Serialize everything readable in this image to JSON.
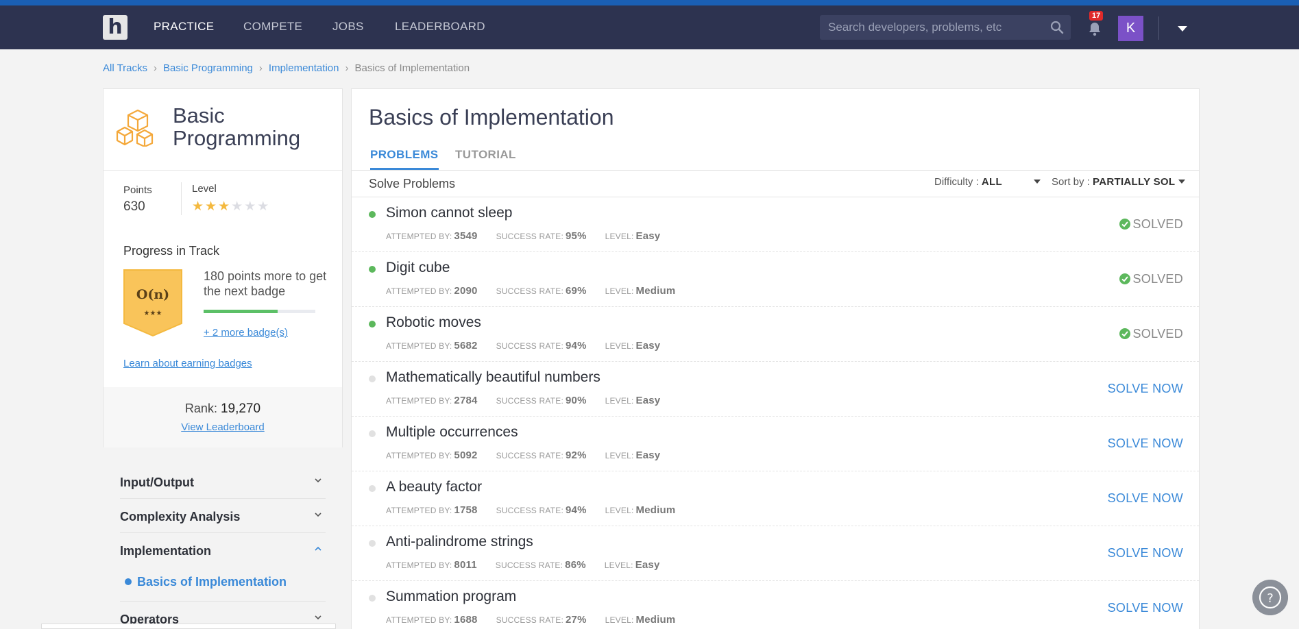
{
  "nav": {
    "logo": "h",
    "links": [
      "PRACTICE",
      "COMPETE",
      "JOBS",
      "LEADERBOARD"
    ],
    "search_placeholder": "Search developers, problems, etc",
    "notifications": "17",
    "avatar": "K"
  },
  "breadcrumb": [
    "All Tracks",
    "Basic Programming",
    "Implementation",
    "Basics of Implementation"
  ],
  "sidebar": {
    "track_title": "Basic Programming",
    "points_label": "Points",
    "points": "630",
    "level_label": "Level",
    "level_stars": 3,
    "level_max": 6,
    "progress_title": "Progress in Track",
    "badge_text": "O(n)",
    "badge_stars": "★★★",
    "progress_text": "180 points more to get the next badge",
    "progress": 0.66,
    "more_badges": "+ 2 more badge(s)",
    "learn_link": "Learn about earning badges",
    "rank_label": "Rank: ",
    "rank": "19,270",
    "view_leaderboard": "View Leaderboard",
    "topics": [
      "Input/Output",
      "Complexity Analysis",
      "Implementation",
      "Operators"
    ],
    "active_subtopic": "Basics of Implementation"
  },
  "main": {
    "title": "Basics of Implementation",
    "tabs": [
      "PROBLEMS",
      "TUTORIAL"
    ],
    "solve_label": "Solve Problems",
    "difficulty_label": "Difficulty : ",
    "difficulty_value": "ALL",
    "sort_label": "Sort by : ",
    "sort_value": "PARTIALLY SOL",
    "meta_labels": {
      "attempted": "ATTEMPTED BY:",
      "success": "SUCCESS RATE:",
      "level": "LEVEL:"
    },
    "problems": [
      {
        "name": "Simon cannot sleep",
        "attempted": "3549",
        "success": "95%",
        "level": "Easy",
        "status": "SOLVED"
      },
      {
        "name": "Digit cube",
        "attempted": "2090",
        "success": "69%",
        "level": "Medium",
        "status": "SOLVED"
      },
      {
        "name": "Robotic moves",
        "attempted": "5682",
        "success": "94%",
        "level": "Easy",
        "status": "SOLVED"
      },
      {
        "name": "Mathematically beautiful numbers",
        "attempted": "2784",
        "success": "90%",
        "level": "Easy",
        "status": "SOLVE NOW"
      },
      {
        "name": "Multiple occurrences",
        "attempted": "5092",
        "success": "92%",
        "level": "Easy",
        "status": "SOLVE NOW"
      },
      {
        "name": "A beauty factor",
        "attempted": "1758",
        "success": "94%",
        "level": "Medium",
        "status": "SOLVE NOW"
      },
      {
        "name": "Anti-palindrome strings",
        "attempted": "8011",
        "success": "86%",
        "level": "Easy",
        "status": "SOLVE NOW"
      },
      {
        "name": "Summation program",
        "attempted": "1688",
        "success": "27%",
        "level": "Medium",
        "status": "SOLVE NOW"
      }
    ]
  },
  "colors": {
    "nav_bg": "#2d3350",
    "accent": "#3a89d8",
    "solved": "#5cb85c",
    "badge": "#f9c45a"
  }
}
